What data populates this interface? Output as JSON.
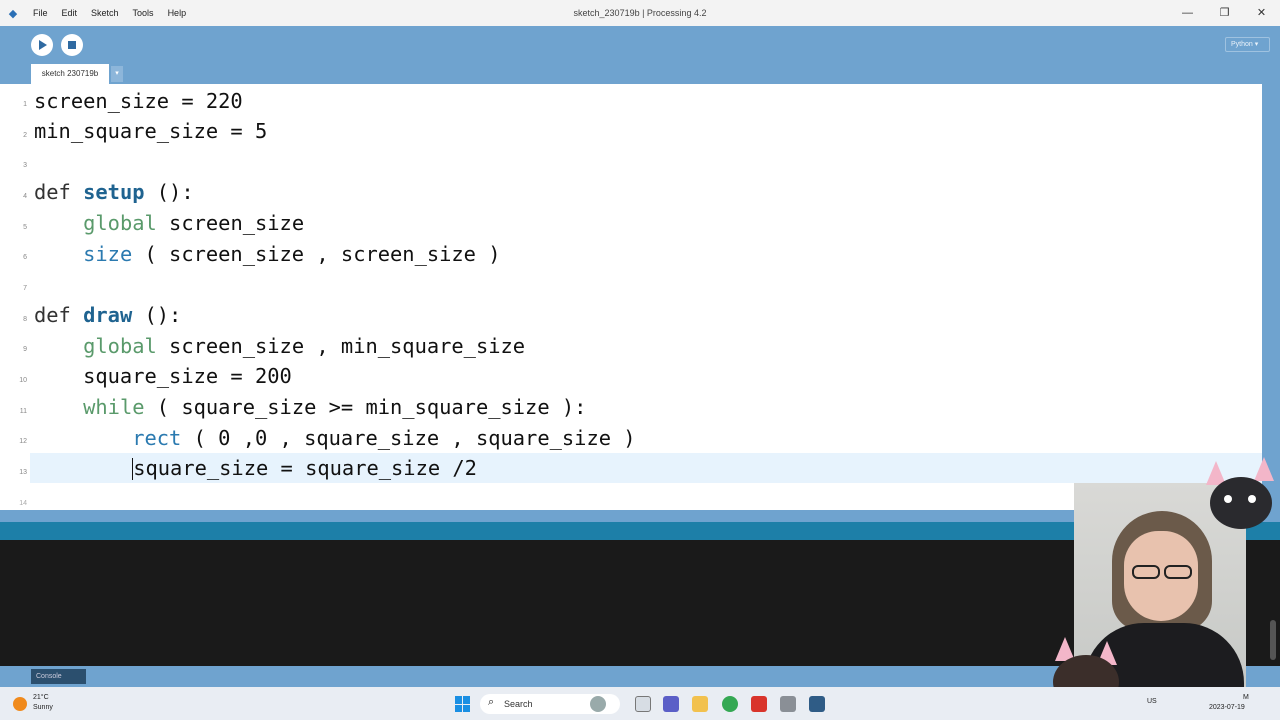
{
  "window": {
    "title": "sketch_230719b | Processing 4.2",
    "controls": {
      "minimize": "—",
      "maximize": "❐",
      "close": "✕"
    }
  },
  "menu": [
    "File",
    "Edit",
    "Sketch",
    "Tools",
    "Help"
  ],
  "toolbar": {
    "mode": "Python ▾"
  },
  "tabs": {
    "active": "sketch 230719b",
    "arrow": "▾"
  },
  "editor": {
    "lines": [
      {
        "n": "1",
        "text": "screen_size = 220"
      },
      {
        "n": "2",
        "text": "min_square_size = 5"
      },
      {
        "n": "3",
        "text": ""
      },
      {
        "n": "4",
        "text": "def setup ():"
      },
      {
        "n": "5",
        "text": "    global screen_size"
      },
      {
        "n": "6",
        "text": "    size ( screen_size , screen_size )"
      },
      {
        "n": "7",
        "text": ""
      },
      {
        "n": "8",
        "text": "def draw ():"
      },
      {
        "n": "9",
        "text": "    global screen_size , min_square_size"
      },
      {
        "n": "10",
        "text": "    square_size = 200"
      },
      {
        "n": "11",
        "text": "    while ( square_size >= min_square_size ):"
      },
      {
        "n": "12",
        "text": "        rect ( 0 ,0 , square_size , square_size )"
      },
      {
        "n": "13",
        "text": "        square_size = square_size /2"
      }
    ],
    "next_line_number": "14",
    "active_line": "13"
  },
  "console": {
    "tab_label": "Console"
  },
  "taskbar": {
    "weather_temp": "21°C",
    "weather_cond": "Sunny",
    "search_label": "Search",
    "lang": "US",
    "time": "M",
    "date": "2023-07-19"
  },
  "colors": {
    "chrome": "#6fa3cf",
    "separator": "#1d7fa8",
    "console_bg": "#1a1a1a",
    "keyword_green": "#5a9a6b",
    "function_blue": "#1f6390"
  }
}
